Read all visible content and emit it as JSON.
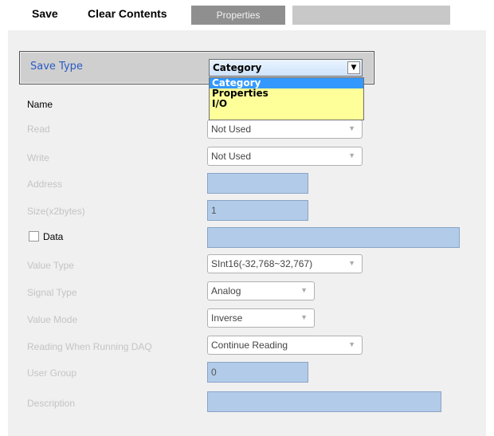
{
  "toolbar": {
    "save_label": "Save",
    "clear_label": "Clear Contents",
    "properties_tab": "Properties"
  },
  "save_type": {
    "label": "Save Type",
    "selected": "Category",
    "options": [
      "Category",
      "Properties",
      "I/O"
    ]
  },
  "fields": {
    "name_label": "Name",
    "read_label": "Read",
    "read_value": "Not Used",
    "write_label": "Write",
    "write_value": "Not Used",
    "address_label": "Address",
    "address_value": "",
    "size_label": "Size(x2bytes)",
    "size_value": "1",
    "data_label": "Data",
    "data_value": "",
    "value_type_label": "Value Type",
    "value_type_value": "SInt16(-32,768~32,767)",
    "signal_type_label": "Signal Type",
    "signal_type_value": "Analog",
    "value_mode_label": "Value Mode",
    "value_mode_value": "Inverse",
    "reading_label": "Reading When Running DAQ",
    "reading_value": "Continue Reading",
    "user_group_label": "User Group",
    "user_group_value": "0",
    "description_label": "Description",
    "description_value": ""
  },
  "icons": {
    "dropdown_arrow": "▼"
  }
}
